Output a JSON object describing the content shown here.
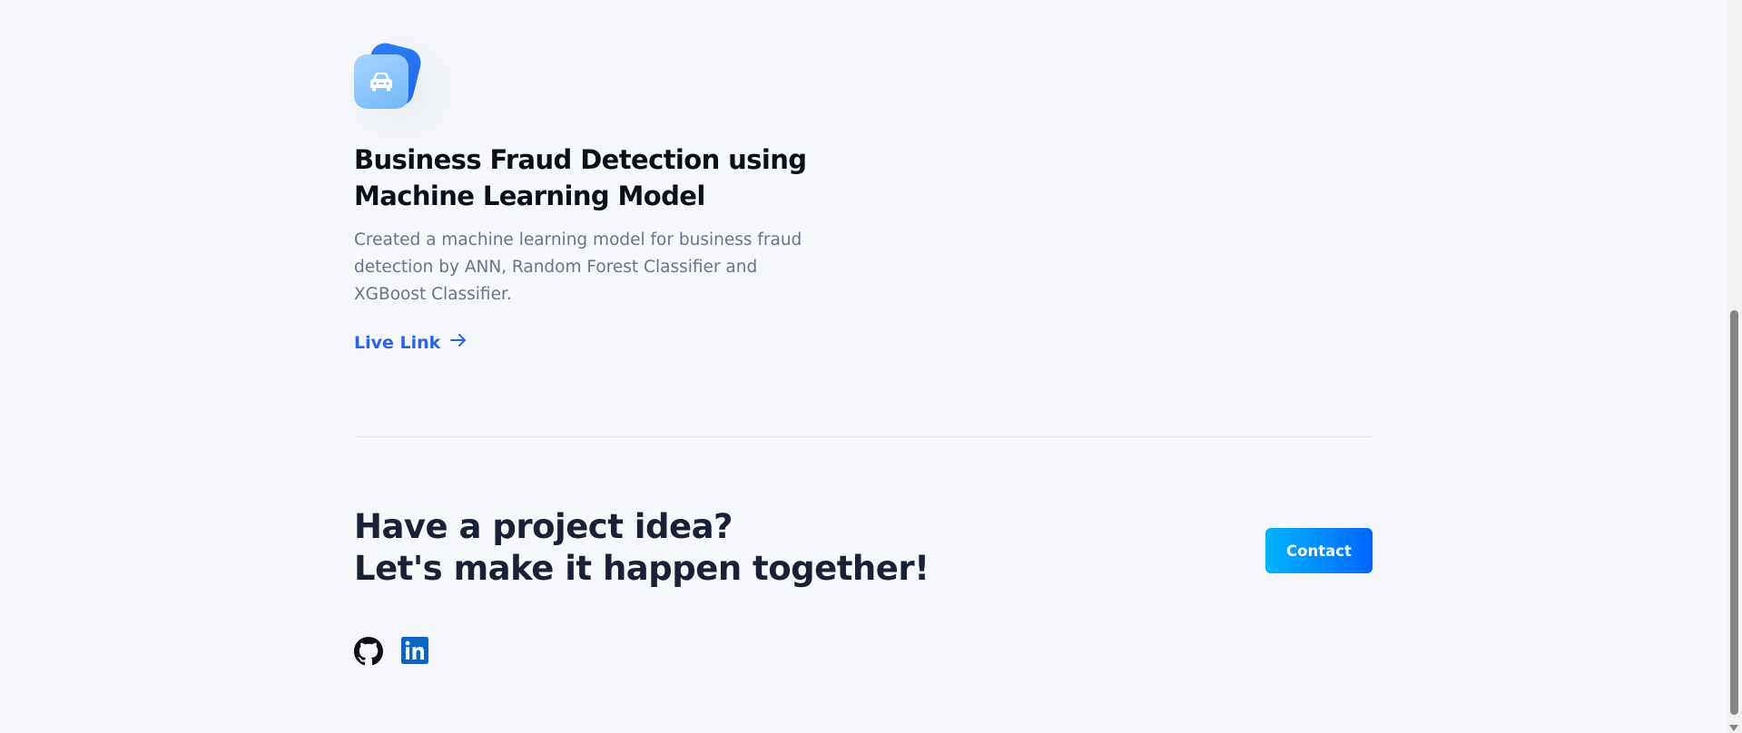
{
  "project": {
    "icon": "car-icon",
    "title": "Business Fraud Detection using Machine Learning Model",
    "description": "Created a machine learning model for business fraud detection by ANN, Random Forest Classifier and XGBoost Classifier.",
    "link_label": "Live Link",
    "link_icon": "arrow-right-icon"
  },
  "cta": {
    "line1": "Have a project idea?",
    "line2": "Let's make it happen together!",
    "button_label": "Contact"
  },
  "socials": [
    {
      "name": "github",
      "icon": "github-icon"
    },
    {
      "name": "linkedin",
      "icon": "linkedin-icon"
    }
  ],
  "colors": {
    "background": "#f5f7fa",
    "link": "#2a63e4",
    "heading": "#1a2035",
    "button_gradient_start": "#00b4ff",
    "button_gradient_end": "#0066ff",
    "linkedin": "#0a66c2"
  }
}
